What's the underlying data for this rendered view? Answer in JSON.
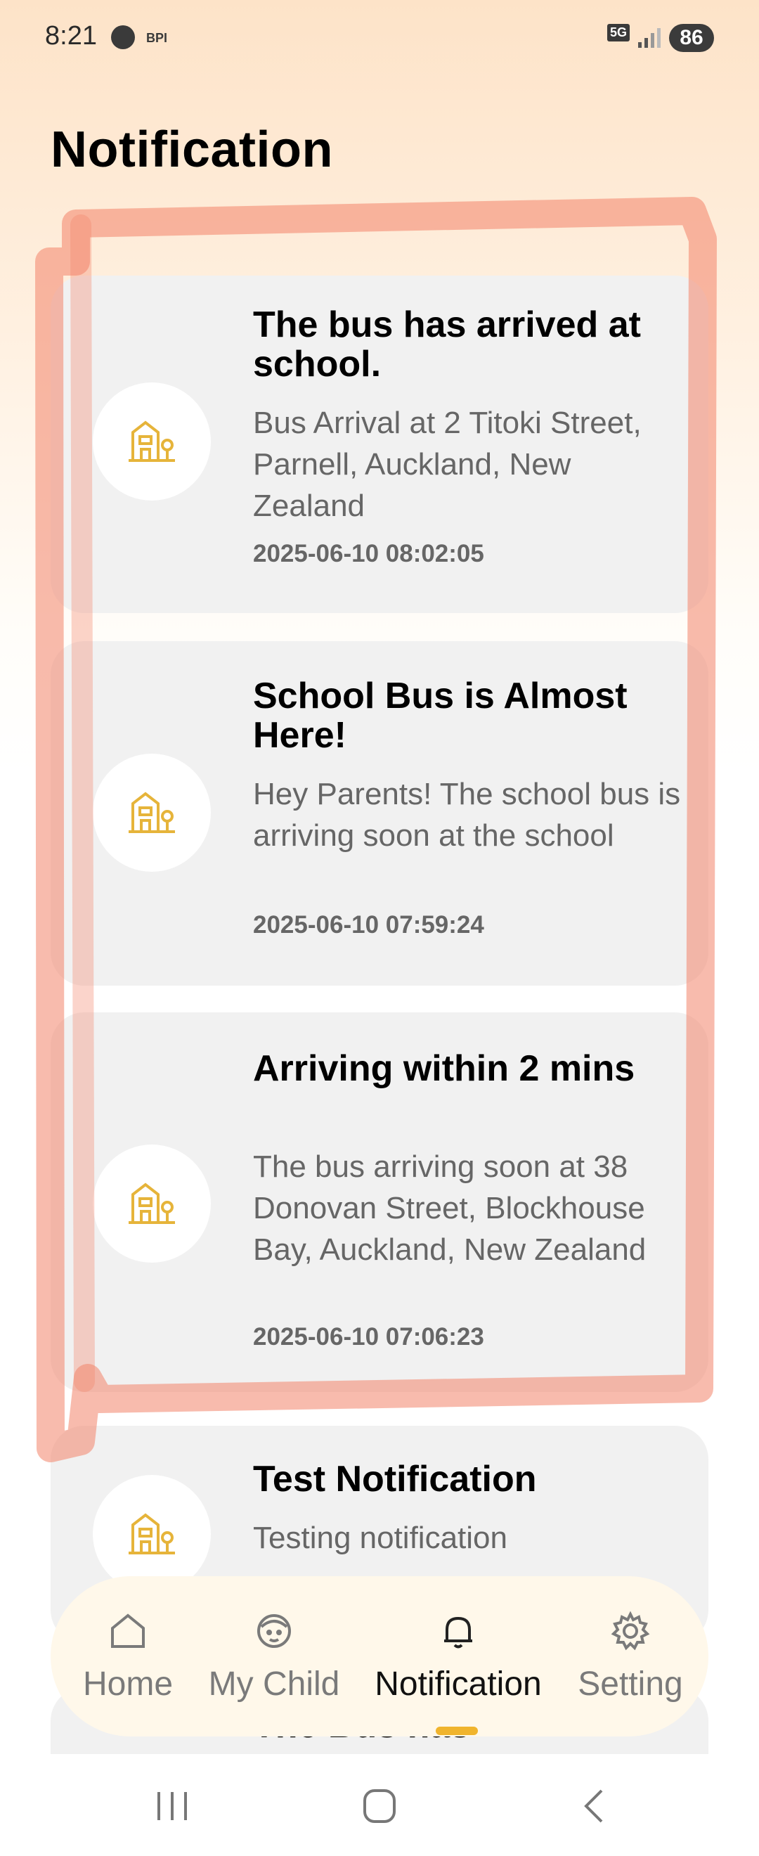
{
  "status_bar": {
    "time": "8:21",
    "carrier_label": "BPI",
    "network": "5G",
    "battery": "86"
  },
  "page": {
    "title": "Notification"
  },
  "notifications": [
    {
      "title": "The bus has arrived at school.",
      "body": "Bus Arrival at 2 Titoki Street, Parnell, Auckland, New Zealand",
      "time": "2025-06-10 08:02:05",
      "icon": "school-icon"
    },
    {
      "title": "School Bus is Almost Here!",
      "body": "Hey Parents! The school bus is arriving soon at the school",
      "time": "2025-06-10 07:59:24",
      "icon": "school-icon"
    },
    {
      "title": "Arriving within 2 mins",
      "body": "The bus arriving soon at 38 Donovan Street, Blockhouse Bay, Auckland, New Zealand",
      "time": "2025-06-10 07:06:23",
      "icon": "school-icon"
    },
    {
      "title": "Test Notification",
      "body": "Testing notification",
      "icon": "school-icon"
    },
    {
      "title": "The Bus has",
      "icon": "school-icon"
    }
  ],
  "bottom_nav": {
    "items": [
      {
        "label": "Home",
        "icon": "home-icon",
        "active": false
      },
      {
        "label": "My Child",
        "icon": "child-face-icon",
        "active": false
      },
      {
        "label": "Notification",
        "icon": "bell-icon",
        "active": true
      },
      {
        "label": "Setting",
        "icon": "gear-icon",
        "active": false
      }
    ]
  },
  "colors": {
    "accent": "#e6b43a",
    "annotation": "#f3846a",
    "card_bg": "#f1f1f1",
    "nav_bg": "#fff8ea"
  }
}
